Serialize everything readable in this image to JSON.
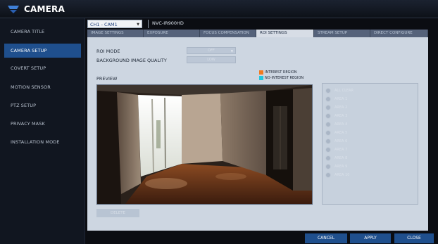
{
  "app": {
    "title": "CAMERA",
    "logo_icon": "camera-app-icon"
  },
  "sidebar": {
    "items": [
      {
        "label": "CAMERA TITLE",
        "active": false
      },
      {
        "label": "CAMERA SETUP",
        "active": true
      },
      {
        "label": "COVERT SETUP",
        "active": false
      },
      {
        "label": "MOTION SENSOR",
        "active": false
      },
      {
        "label": "PTZ SETUP",
        "active": false
      },
      {
        "label": "PRIVACY MASK",
        "active": false
      },
      {
        "label": "INSTALLATION MODE",
        "active": false
      }
    ]
  },
  "toolbar": {
    "channel_value": "CH1 - CAM1",
    "model_name": "NVC-IR900HD"
  },
  "tabs": [
    {
      "label": "IMAGE SETTINGS",
      "active": false
    },
    {
      "label": "EXPOSURE",
      "active": false
    },
    {
      "label": "FOCUS COMPENSATION",
      "active": false
    },
    {
      "label": "ROI SETTINGS",
      "active": true
    },
    {
      "label": "STREAM SETUP",
      "active": false
    },
    {
      "label": "DIRECT CONFIGURE",
      "active": false
    }
  ],
  "roi": {
    "mode_label": "ROI MODE",
    "mode_value": "OFF",
    "bg_quality_label": "BACKGROUND IMAGE QUALITY",
    "bg_quality_value": "LOW",
    "preview_label": "PREVIEW",
    "legend": [
      {
        "label": "INTEREST REGION",
        "color": "#f07a20"
      },
      {
        "label": "NO-INTEREST REGION",
        "color": "#22c7e0"
      }
    ],
    "areas": [
      "ALL CLEAR",
      "AREA 1",
      "AREA 2",
      "AREA 3",
      "AREA 4",
      "AREA 5",
      "AREA 6",
      "AREA 7",
      "AREA 8",
      "AREA 9",
      "AREA 10"
    ],
    "delete_label": "DELETE"
  },
  "footer": {
    "cancel_label": "CANCEL",
    "apply_label": "APPLY",
    "close_label": "CLOSE"
  },
  "colors": {
    "accent": "#1f4f8d",
    "panel": "#cdd6e1",
    "background": "#0b0d12"
  }
}
